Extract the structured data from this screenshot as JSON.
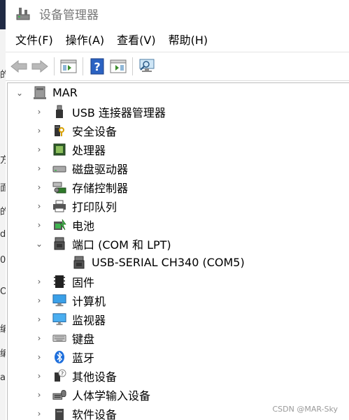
{
  "window": {
    "title": "设备管理器"
  },
  "menu": [
    "文件(F)",
    "操作(A)",
    "查看(V)",
    "帮助(H)"
  ],
  "tree": {
    "root": "MAR",
    "items": [
      {
        "label": "USB 连接器管理器",
        "icon": "usb-connector-icon"
      },
      {
        "label": "安全设备",
        "icon": "security-device-icon"
      },
      {
        "label": "处理器",
        "icon": "processor-icon"
      },
      {
        "label": "磁盘驱动器",
        "icon": "disk-drive-icon"
      },
      {
        "label": "存储控制器",
        "icon": "storage-controller-icon"
      },
      {
        "label": "打印队列",
        "icon": "print-queue-icon"
      },
      {
        "label": "电池",
        "icon": "battery-icon"
      },
      {
        "label": "端口 (COM 和 LPT)",
        "icon": "port-icon",
        "expanded": true,
        "children": [
          {
            "label": "USB-SERIAL CH340 (COM5)",
            "icon": "port-icon"
          }
        ]
      },
      {
        "label": "固件",
        "icon": "firmware-icon"
      },
      {
        "label": "计算机",
        "icon": "computer-icon"
      },
      {
        "label": "监视器",
        "icon": "monitor-icon"
      },
      {
        "label": "键盘",
        "icon": "keyboard-icon"
      },
      {
        "label": "蓝牙",
        "icon": "bluetooth-icon"
      },
      {
        "label": "其他设备",
        "icon": "other-device-icon"
      },
      {
        "label": "人体学输入设备",
        "icon": "hid-icon"
      },
      {
        "label": "软件设备",
        "icon": "software-device-icon"
      }
    ]
  },
  "watermark": "CSDN @MAR-Sky",
  "background_window": {
    "glyphs": [
      "的",
      "方",
      "面",
      "的",
      "di",
      "0",
      "Or",
      "编",
      "编",
      "a"
    ]
  }
}
